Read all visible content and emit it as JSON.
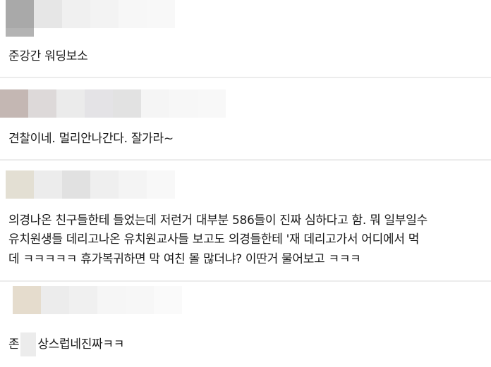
{
  "comments": [
    {
      "text": "준강간 워딩보소"
    },
    {
      "text": "견찰이네. 멀리안나간다. 잘가라~"
    },
    {
      "lines": [
        "의경나온 친구들한테 들었는데 저런거 대부분 586들이 진짜 심하다고 함. 뭐 일부일수",
        "유치원생들 데리고나온 유치원교사들 보고도 의경들한테 '재 데리고가서 어디에서 먹",
        "데 ㅋㅋㅋㅋㅋ 휴가복귀하면 막 여친 몰 많더냐? 이딴거 물어보고 ㅋㅋㅋ"
      ]
    },
    {
      "text_before": "존",
      "text_after": "상스럽네진짜ㅋㅋ"
    }
  ]
}
